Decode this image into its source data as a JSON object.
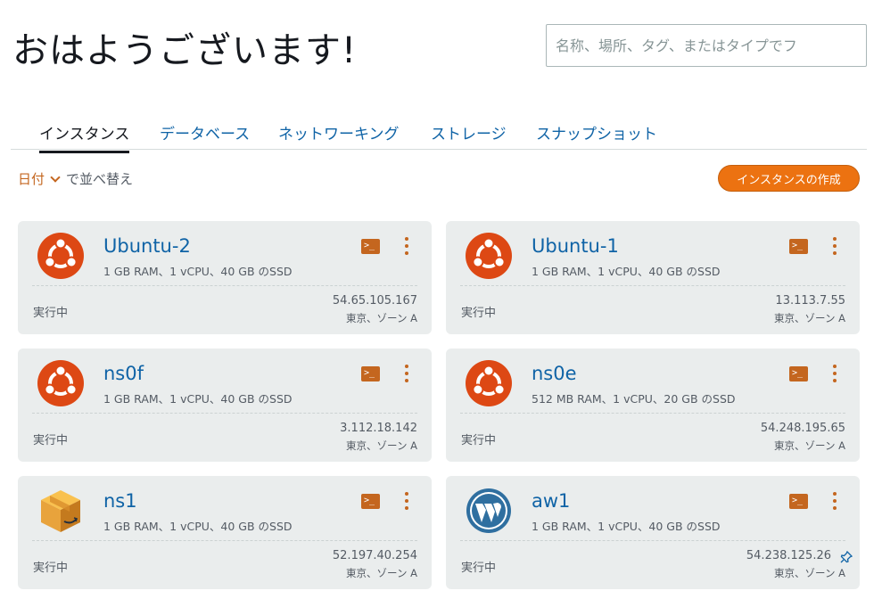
{
  "greeting": "おはようございます!",
  "search": {
    "placeholder": "名称、場所、タグ、またはタイプでフ"
  },
  "tabs": [
    {
      "label": "インスタンス",
      "active": true
    },
    {
      "label": "データベース",
      "active": false
    },
    {
      "label": "ネットワーキング",
      "active": false
    },
    {
      "label": "ストレージ",
      "active": false
    },
    {
      "label": "スナップショット",
      "active": false
    }
  ],
  "sort": {
    "key": "日付",
    "label": "で並べ替え"
  },
  "create_button": "インスタンスの作成",
  "colors": {
    "accent": "#ec7211",
    "link": "#0f63a6",
    "card_bg": "#eaeded",
    "ubuntu": "#dd4814"
  },
  "instances": [
    {
      "name": "Ubuntu-2",
      "spec": "1 GB RAM、1 vCPU、40 GB のSSD",
      "status": "実行中",
      "ip": "54.65.105.167",
      "zone": "東京、ゾーン A",
      "icon": "ubuntu-logo",
      "pinned": false
    },
    {
      "name": "Ubuntu-1",
      "spec": "1 GB RAM、1 vCPU、40 GB のSSD",
      "status": "実行中",
      "ip": "13.113.7.55",
      "zone": "東京、ゾーン A",
      "icon": "ubuntu-logo",
      "pinned": false
    },
    {
      "name": "ns0f",
      "spec": "1 GB RAM、1 vCPU、40 GB のSSD",
      "status": "実行中",
      "ip": "3.112.18.142",
      "zone": "東京、ゾーン A",
      "icon": "ubuntu-logo",
      "pinned": false
    },
    {
      "name": "ns0e",
      "spec": "512 MB RAM、1 vCPU、20 GB のSSD",
      "status": "実行中",
      "ip": "54.248.195.65",
      "zone": "東京、ゾーン A",
      "icon": "ubuntu-logo",
      "pinned": false
    },
    {
      "name": "ns1",
      "spec": "1 GB RAM、1 vCPU、40 GB のSSD",
      "status": "実行中",
      "ip": "52.197.40.254",
      "zone": "東京、ゾーン A",
      "icon": "amazon-box-logo",
      "pinned": false
    },
    {
      "name": "aw1",
      "spec": "1 GB RAM、1 vCPU、40 GB のSSD",
      "status": "実行中",
      "ip": "54.238.125.26",
      "zone": "東京、ゾーン A",
      "icon": "wordpress-logo",
      "pinned": true
    }
  ]
}
